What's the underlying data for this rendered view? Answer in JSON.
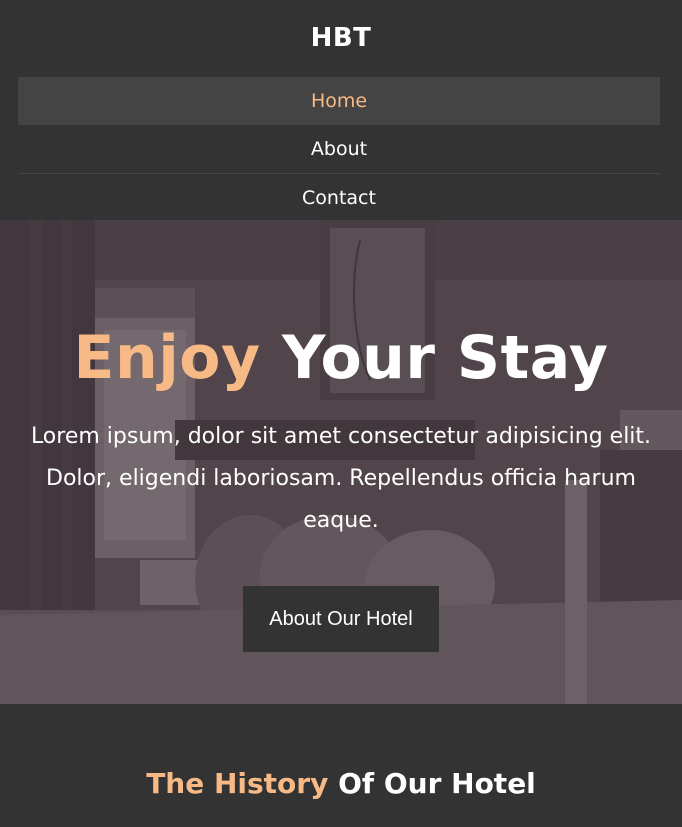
{
  "brand": "HBT",
  "nav": {
    "items": [
      {
        "label": "Home",
        "active": true
      },
      {
        "label": "About",
        "active": false
      },
      {
        "label": "Contact",
        "active": false
      }
    ]
  },
  "hero": {
    "title_accent": "Enjoy",
    "title_rest": " Your Stay",
    "text": "Lorem ipsum, dolor sit amet consectetur adipisicing elit. Dolor, eligendi laboriosam. Repellendus officia harum eaque.",
    "button_label": "About Our Hotel"
  },
  "history": {
    "title_accent": "The History",
    "title_rest": " Of Our Hotel"
  },
  "colors": {
    "background": "#333333",
    "accent": "#f7b985",
    "nav_active_bg": "#444444",
    "hero_tint": "#544b50"
  }
}
